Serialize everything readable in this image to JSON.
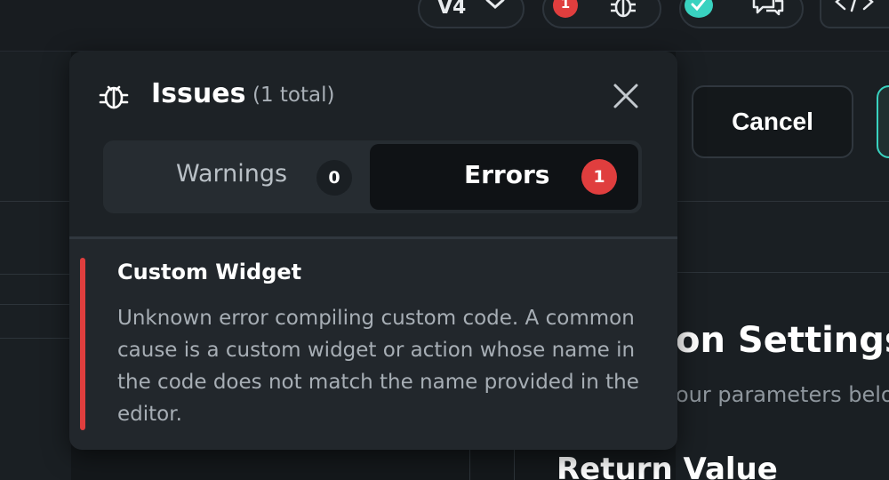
{
  "topbar": {
    "version_label": "V4",
    "issues_badge": "1"
  },
  "background": {
    "cancel_label": "Cancel",
    "heading_partial": "on Settings",
    "sub_partial": "our parameters belo",
    "return_partial": "Return Value"
  },
  "issues_panel": {
    "title": "Issues",
    "count_text": "(1 total)",
    "tabs": {
      "warnings": {
        "label": "Warnings",
        "count": "0"
      },
      "errors": {
        "label": "Errors",
        "count": "1",
        "active": true
      }
    },
    "items": [
      {
        "title": "Custom Widget",
        "message": "Unknown error compiling custom code. A common cause is a custom widget or action whose name in the code does not match the name provided in the editor.",
        "severity_color": "#e03e3e"
      }
    ]
  },
  "colors": {
    "error_red": "#e03e3e",
    "accent_teal": "#39d2c0",
    "panel_bg": "#22272c"
  },
  "icons": [
    "bug-icon",
    "close-icon",
    "chevron-down-icon",
    "check-icon",
    "chat-icon",
    "code-icon"
  ]
}
